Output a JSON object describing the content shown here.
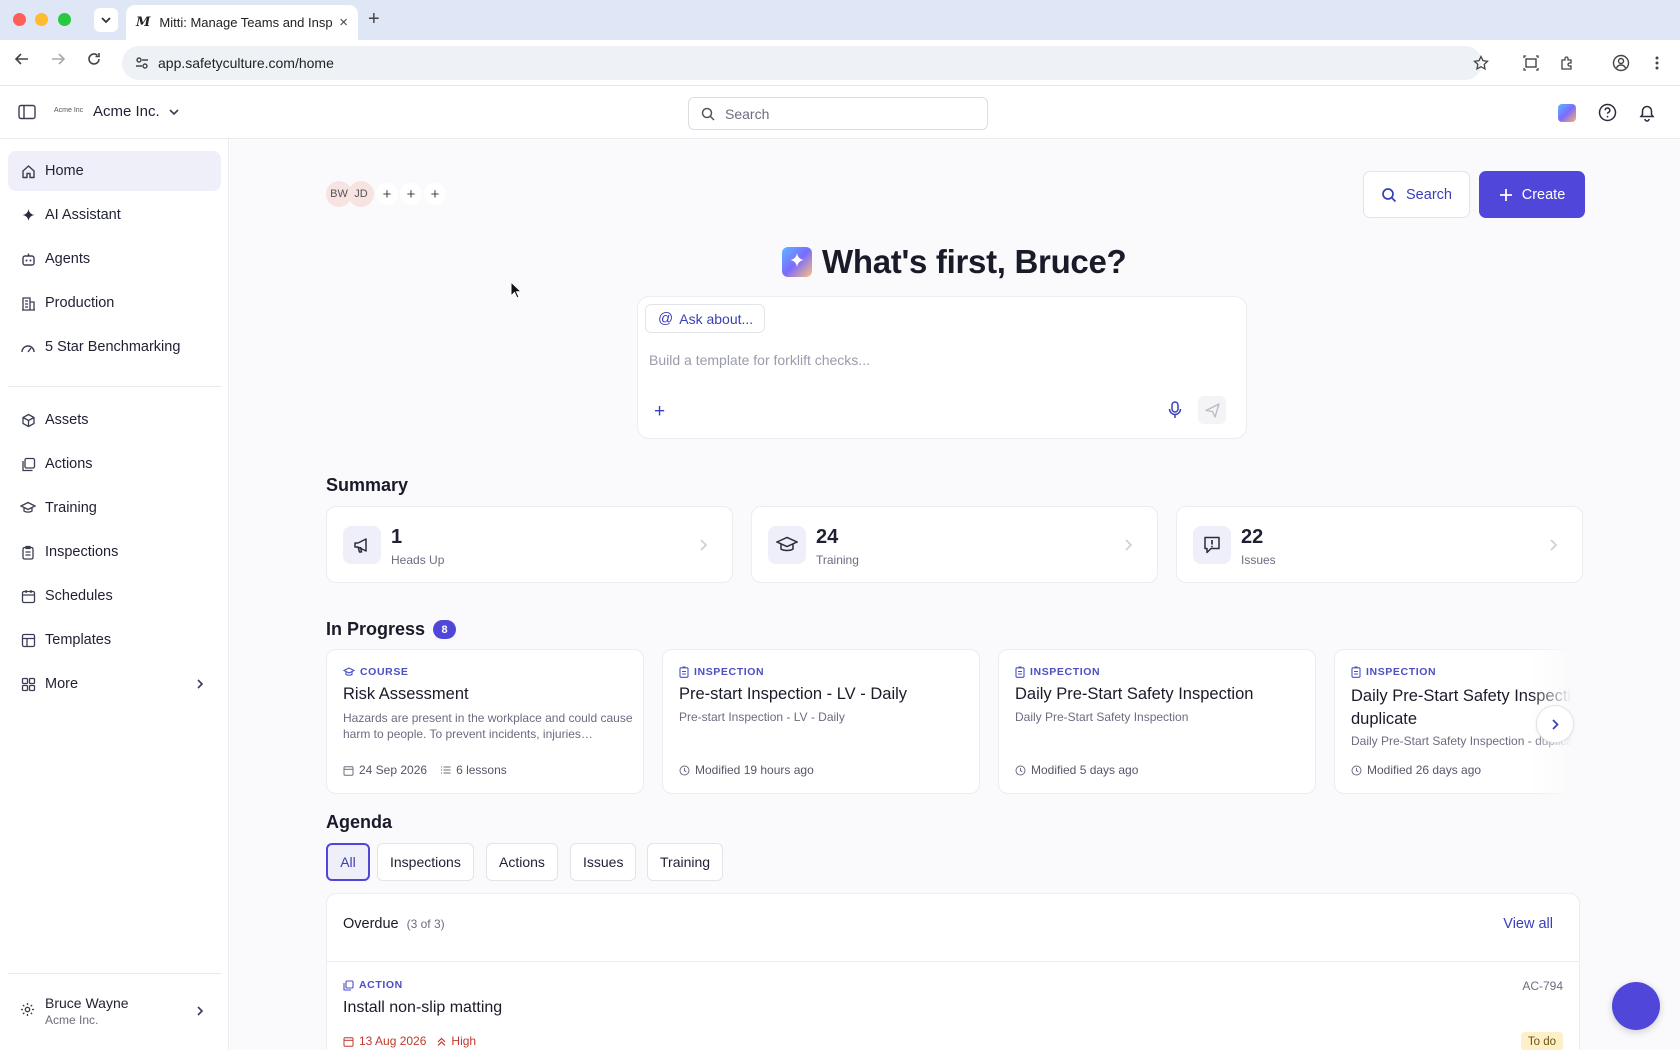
{
  "browser": {
    "tab_title": "Mitti: Manage Teams and Inspections",
    "tab_favicon": "M",
    "new_tab": "+",
    "close_tab": "×",
    "url": "app.safetyculture.com/home"
  },
  "header": {
    "org_logo_text": "Acme Inc",
    "org_name": "Acme Inc.",
    "search_placeholder": "Search"
  },
  "sidebar": {
    "items": [
      {
        "label": "Home",
        "icon": "home-icon"
      },
      {
        "label": "AI Assistant",
        "icon": "sparkle-icon"
      },
      {
        "label": "Agents",
        "icon": "robot-icon"
      },
      {
        "label": "Production",
        "icon": "building-icon"
      },
      {
        "label": "5 Star Benchmarking",
        "icon": "gauge-icon"
      },
      {
        "label": "Assets",
        "icon": "cube-icon"
      },
      {
        "label": "Actions",
        "icon": "actions-icon"
      },
      {
        "label": "Training",
        "icon": "graduation-cap-icon"
      },
      {
        "label": "Inspections",
        "icon": "clipboard-icon"
      },
      {
        "label": "Schedules",
        "icon": "calendar-icon"
      },
      {
        "label": "Templates",
        "icon": "template-icon"
      },
      {
        "label": "More",
        "icon": "grid-icon"
      }
    ],
    "user": {
      "name": "Bruce Wayne",
      "org": "Acme Inc."
    }
  },
  "main": {
    "avatars": [
      "BW",
      "JD"
    ],
    "search_button": "Search",
    "create_button": "Create",
    "greeting": "What's first, Bruce?",
    "ask_about": "Ask about...",
    "prompt_placeholder": "Build a template for forklift checks...",
    "summary_title": "Summary",
    "summary": [
      {
        "count": "1",
        "label": "Heads Up"
      },
      {
        "count": "24",
        "label": "Training"
      },
      {
        "count": "22",
        "label": "Issues"
      }
    ],
    "in_progress_title": "In Progress",
    "in_progress_count": "8",
    "in_progress": [
      {
        "type": "COURSE",
        "title": "Risk Assessment",
        "desc": "Hazards are present in the workplace and could cause harm to people. To prevent incidents, injuries…",
        "date": "24 Sep 2026",
        "lessons": "6 lessons"
      },
      {
        "type": "INSPECTION",
        "title": "Pre-start Inspection - LV - Daily",
        "desc": "Pre-start Inspection - LV - Daily",
        "meta": "Modified 19 hours ago"
      },
      {
        "type": "INSPECTION",
        "title": "Daily Pre-Start Safety Inspection",
        "desc": "Daily Pre-Start Safety Inspection",
        "meta": "Modified 5 days ago"
      },
      {
        "type": "INSPECTION",
        "title": "Daily Pre-Start Safety Inspection duplicate",
        "desc": "Daily Pre-Start Safety Inspection - duplicate",
        "meta": "Modified 26 days ago"
      }
    ],
    "agenda_title": "Agenda",
    "agenda_filters": [
      "All",
      "Inspections",
      "Actions",
      "Issues",
      "Training"
    ],
    "overdue_label": "Overdue",
    "overdue_count": "(3 of 3)",
    "view_all": "View all",
    "agenda_item": {
      "type": "ACTION",
      "title": "Install non-slip matting",
      "id": "AC-794",
      "date": "13 Aug 2026",
      "priority": "High",
      "status": "To do"
    }
  },
  "colors": {
    "accent": "#5046d9",
    "titlebar": "#dfe6f5",
    "danger": "#c0392b"
  }
}
